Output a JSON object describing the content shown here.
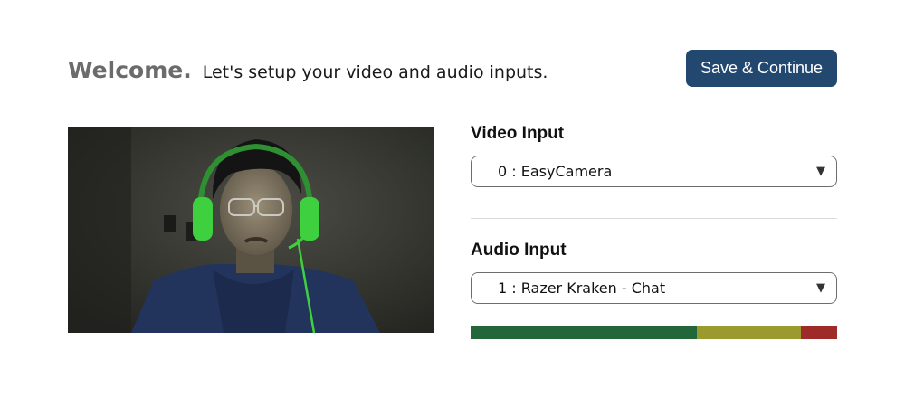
{
  "header": {
    "welcome": "Welcome.",
    "subtitle": "Let's setup your video and audio inputs."
  },
  "actions": {
    "save_label": "Save & Continue"
  },
  "video": {
    "label": "Video Input",
    "selected": "0 : EasyCamera"
  },
  "audio": {
    "label": "Audio Input",
    "selected": "1 : Razer Kraken - Chat"
  },
  "icons": {
    "dropdown": "chevron-down-icon"
  },
  "level_meter": {
    "segments": [
      {
        "zone": "green",
        "fraction": 0.617,
        "color": "#23663a"
      },
      {
        "zone": "yellow",
        "fraction": 0.284,
        "color": "#9a9a2e"
      },
      {
        "zone": "red",
        "fraction": 0.099,
        "color": "#9e2a2a"
      }
    ]
  },
  "colors": {
    "primary_button": "#22486f",
    "headset": "#3fd03f"
  }
}
